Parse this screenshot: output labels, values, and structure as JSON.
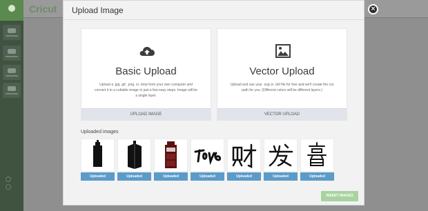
{
  "app": {
    "logo": "Cricut"
  },
  "modal": {
    "title": "Upload Image",
    "basic": {
      "heading": "Basic Upload",
      "description": "Upload a .jpg .gif, .png, or .bmp from your own computer and convert it to a cuttable image in just a few easy steps. Image will be a single layer.",
      "action": "UPLOAD IMAGE",
      "icon": "cloud-upload-icon"
    },
    "vector": {
      "heading": "Vector Upload",
      "description": "Upload and use your .svg or .dxf file for free and we'll create the cut path for you. (Different colors will be different layers.)",
      "action": "VECTOR UPLOAD",
      "icon": "picture-icon"
    },
    "uploaded_label": "Uploaded images",
    "thumbnails": [
      {
        "button": "Uploaded",
        "image": "police-box"
      },
      {
        "button": "Uploaded",
        "image": "police-box-angled"
      },
      {
        "button": "Uploaded",
        "image": "red-police-box"
      },
      {
        "button": "Uploaded",
        "image": "calligraphy-text"
      },
      {
        "button": "Uploaded",
        "image": "chinese-character-cai"
      },
      {
        "button": "Uploaded",
        "image": "chinese-character-fa"
      },
      {
        "button": "Uploaded",
        "image": "chinese-character-xi"
      }
    ],
    "insert_button": "INSERT IMAGES",
    "close_glyph": "×"
  },
  "colors": {
    "uploaded_button": "#5b9bc9",
    "insert_button": "#a8d3a0",
    "card_action": "#e2e4ec"
  }
}
